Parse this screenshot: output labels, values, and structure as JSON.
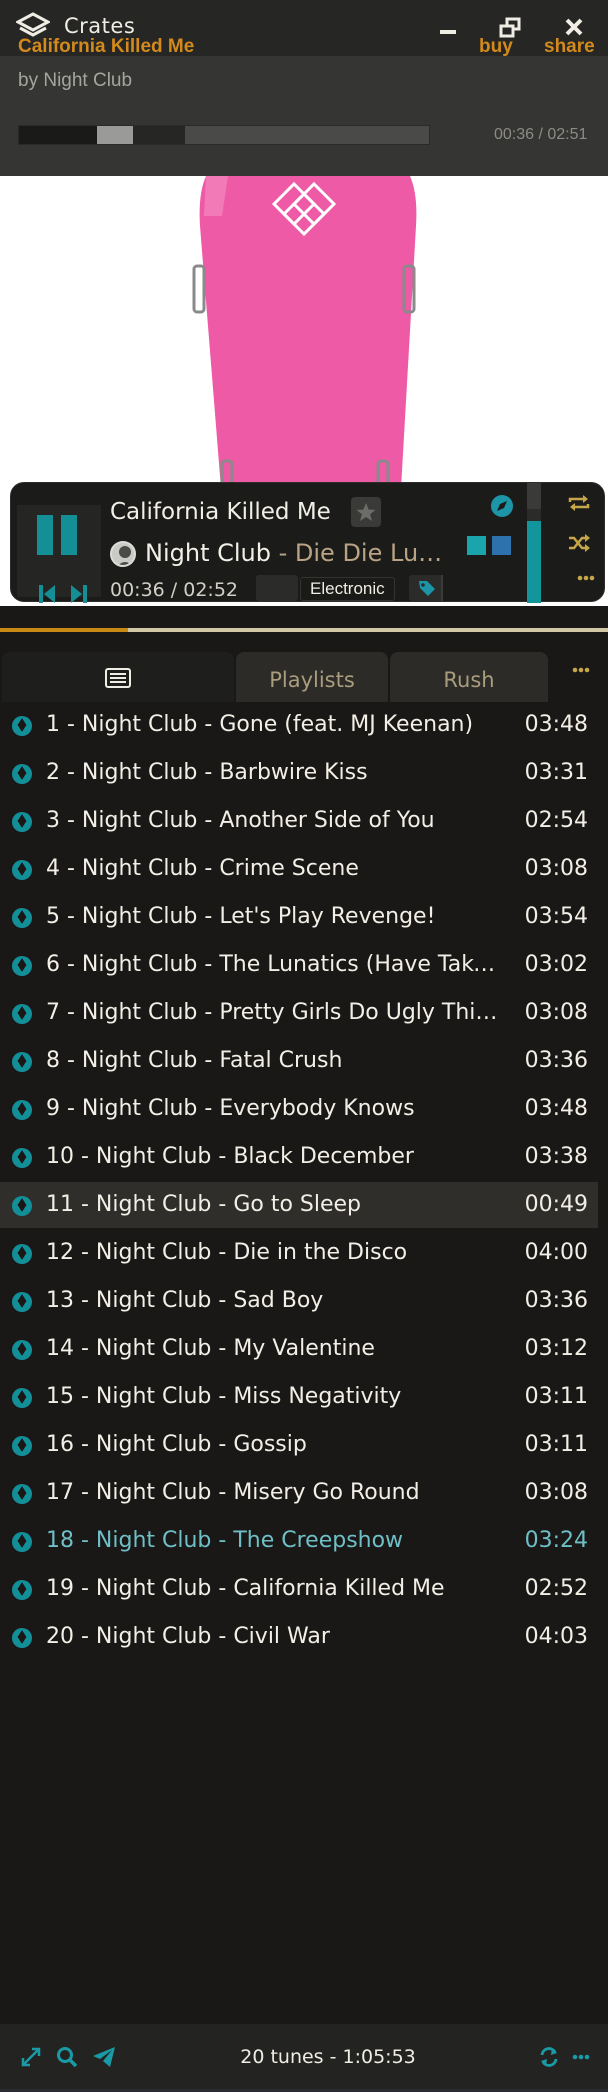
{
  "app": {
    "name": "Crates"
  },
  "header": {
    "track_title": "California Killed Me",
    "buy_label": "buy",
    "share_label": "share",
    "artist_line": "by Night Club",
    "time": "00:36 / 02:51",
    "progress_fraction": 0.21
  },
  "now_playing": {
    "title": "California Killed Me",
    "artist": "Night Club",
    "album_sep": " - ",
    "album": "Die Die Lu…",
    "time": "00:36 / 02:52",
    "genre": "Electronic",
    "volume_fraction": 0.68
  },
  "tabs": [
    {
      "label": "",
      "icon": "list-icon",
      "active": true
    },
    {
      "label": "Playlists",
      "active": false
    },
    {
      "label": "Rush",
      "active": false
    }
  ],
  "tracks": [
    {
      "title": "1 - Night Club - Gone (feat. MJ Keenan)",
      "duration": "03:48"
    },
    {
      "title": "2 - Night Club - Barbwire Kiss",
      "duration": "03:31"
    },
    {
      "title": "3 - Night Club - Another Side of You",
      "duration": "02:54"
    },
    {
      "title": "4 - Night Club - Crime Scene",
      "duration": "03:08"
    },
    {
      "title": "5 - Night Club - Let's Play Revenge!",
      "duration": "03:54"
    },
    {
      "title": "6 - Night Club - The Lunatics (Have Take…",
      "duration": "03:02"
    },
    {
      "title": "7 - Night Club - Pretty Girls Do Ugly Thin…",
      "duration": "03:08"
    },
    {
      "title": "8 - Night Club - Fatal Crush",
      "duration": "03:36"
    },
    {
      "title": "9 - Night Club - Everybody Knows",
      "duration": "03:48"
    },
    {
      "title": "10 - Night Club - Black December",
      "duration": "03:38"
    },
    {
      "title": "11 - Night Club - Go to Sleep",
      "duration": "00:49"
    },
    {
      "title": "12 - Night Club - Die in the Disco",
      "duration": "04:00"
    },
    {
      "title": "13 - Night Club - Sad Boy",
      "duration": "03:36"
    },
    {
      "title": "14 - Night Club - My Valentine",
      "duration": "03:12"
    },
    {
      "title": "15 - Night Club - Miss Negativity",
      "duration": "03:11"
    },
    {
      "title": "16 - Night Club - Gossip",
      "duration": "03:11"
    },
    {
      "title": "17 - Night Club - Misery Go Round",
      "duration": "03:08"
    },
    {
      "title": "18 - Night Club - The Creepshow",
      "duration": "03:24"
    },
    {
      "title": "19 - Night Club - California Killed Me",
      "duration": "02:52"
    },
    {
      "title": "20 - Night Club - Civil War",
      "duration": "04:03"
    }
  ],
  "hovered_index": 10,
  "highlight_index": 17,
  "footer": {
    "summary": "20 tunes - 1:05:53"
  },
  "colors": {
    "accent_orange": "#d28a1c",
    "accent_teal": "#13969b",
    "pink": "#ef5aa7"
  }
}
